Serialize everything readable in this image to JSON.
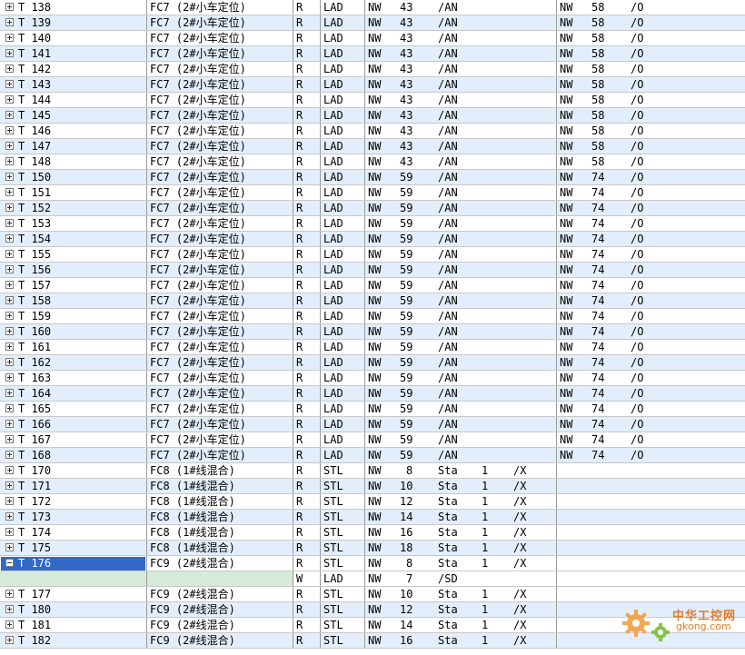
{
  "rows": [
    {
      "name": "T 138",
      "blk": "FC7 (2#小车定位)",
      "rw": "R",
      "lang": "LAD",
      "nw": "NW",
      "n1": "43",
      "a1": "/AN",
      "n2": "NW",
      "m2": "58",
      "a2": "/O"
    },
    {
      "name": "T 139",
      "blk": "FC7 (2#小车定位)",
      "rw": "R",
      "lang": "LAD",
      "nw": "NW",
      "n1": "43",
      "a1": "/AN",
      "n2": "NW",
      "m2": "58",
      "a2": "/O"
    },
    {
      "name": "T 140",
      "blk": "FC7 (2#小车定位)",
      "rw": "R",
      "lang": "LAD",
      "nw": "NW",
      "n1": "43",
      "a1": "/AN",
      "n2": "NW",
      "m2": "58",
      "a2": "/O"
    },
    {
      "name": "T 141",
      "blk": "FC7 (2#小车定位)",
      "rw": "R",
      "lang": "LAD",
      "nw": "NW",
      "n1": "43",
      "a1": "/AN",
      "n2": "NW",
      "m2": "58",
      "a2": "/O"
    },
    {
      "name": "T 142",
      "blk": "FC7 (2#小车定位)",
      "rw": "R",
      "lang": "LAD",
      "nw": "NW",
      "n1": "43",
      "a1": "/AN",
      "n2": "NW",
      "m2": "58",
      "a2": "/O"
    },
    {
      "name": "T 143",
      "blk": "FC7 (2#小车定位)",
      "rw": "R",
      "lang": "LAD",
      "nw": "NW",
      "n1": "43",
      "a1": "/AN",
      "n2": "NW",
      "m2": "58",
      "a2": "/O"
    },
    {
      "name": "T 144",
      "blk": "FC7 (2#小车定位)",
      "rw": "R",
      "lang": "LAD",
      "nw": "NW",
      "n1": "43",
      "a1": "/AN",
      "n2": "NW",
      "m2": "58",
      "a2": "/O"
    },
    {
      "name": "T 145",
      "blk": "FC7 (2#小车定位)",
      "rw": "R",
      "lang": "LAD",
      "nw": "NW",
      "n1": "43",
      "a1": "/AN",
      "n2": "NW",
      "m2": "58",
      "a2": "/O"
    },
    {
      "name": "T 146",
      "blk": "FC7 (2#小车定位)",
      "rw": "R",
      "lang": "LAD",
      "nw": "NW",
      "n1": "43",
      "a1": "/AN",
      "n2": "NW",
      "m2": "58",
      "a2": "/O"
    },
    {
      "name": "T 147",
      "blk": "FC7 (2#小车定位)",
      "rw": "R",
      "lang": "LAD",
      "nw": "NW",
      "n1": "43",
      "a1": "/AN",
      "n2": "NW",
      "m2": "58",
      "a2": "/O"
    },
    {
      "name": "T 148",
      "blk": "FC7 (2#小车定位)",
      "rw": "R",
      "lang": "LAD",
      "nw": "NW",
      "n1": "43",
      "a1": "/AN",
      "n2": "NW",
      "m2": "58",
      "a2": "/O"
    },
    {
      "name": "T 150",
      "blk": "FC7 (2#小车定位)",
      "rw": "R",
      "lang": "LAD",
      "nw": "NW",
      "n1": "59",
      "a1": "/AN",
      "n2": "NW",
      "m2": "74",
      "a2": "/O"
    },
    {
      "name": "T 151",
      "blk": "FC7 (2#小车定位)",
      "rw": "R",
      "lang": "LAD",
      "nw": "NW",
      "n1": "59",
      "a1": "/AN",
      "n2": "NW",
      "m2": "74",
      "a2": "/O"
    },
    {
      "name": "T 152",
      "blk": "FC7 (2#小车定位)",
      "rw": "R",
      "lang": "LAD",
      "nw": "NW",
      "n1": "59",
      "a1": "/AN",
      "n2": "NW",
      "m2": "74",
      "a2": "/O"
    },
    {
      "name": "T 153",
      "blk": "FC7 (2#小车定位)",
      "rw": "R",
      "lang": "LAD",
      "nw": "NW",
      "n1": "59",
      "a1": "/AN",
      "n2": "NW",
      "m2": "74",
      "a2": "/O"
    },
    {
      "name": "T 154",
      "blk": "FC7 (2#小车定位)",
      "rw": "R",
      "lang": "LAD",
      "nw": "NW",
      "n1": "59",
      "a1": "/AN",
      "n2": "NW",
      "m2": "74",
      "a2": "/O"
    },
    {
      "name": "T 155",
      "blk": "FC7 (2#小车定位)",
      "rw": "R",
      "lang": "LAD",
      "nw": "NW",
      "n1": "59",
      "a1": "/AN",
      "n2": "NW",
      "m2": "74",
      "a2": "/O"
    },
    {
      "name": "T 156",
      "blk": "FC7 (2#小车定位)",
      "rw": "R",
      "lang": "LAD",
      "nw": "NW",
      "n1": "59",
      "a1": "/AN",
      "n2": "NW",
      "m2": "74",
      "a2": "/O"
    },
    {
      "name": "T 157",
      "blk": "FC7 (2#小车定位)",
      "rw": "R",
      "lang": "LAD",
      "nw": "NW",
      "n1": "59",
      "a1": "/AN",
      "n2": "NW",
      "m2": "74",
      "a2": "/O"
    },
    {
      "name": "T 158",
      "blk": "FC7 (2#小车定位)",
      "rw": "R",
      "lang": "LAD",
      "nw": "NW",
      "n1": "59",
      "a1": "/AN",
      "n2": "NW",
      "m2": "74",
      "a2": "/O"
    },
    {
      "name": "T 159",
      "blk": "FC7 (2#小车定位)",
      "rw": "R",
      "lang": "LAD",
      "nw": "NW",
      "n1": "59",
      "a1": "/AN",
      "n2": "NW",
      "m2": "74",
      "a2": "/O"
    },
    {
      "name": "T 160",
      "blk": "FC7 (2#小车定位)",
      "rw": "R",
      "lang": "LAD",
      "nw": "NW",
      "n1": "59",
      "a1": "/AN",
      "n2": "NW",
      "m2": "74",
      "a2": "/O"
    },
    {
      "name": "T 161",
      "blk": "FC7 (2#小车定位)",
      "rw": "R",
      "lang": "LAD",
      "nw": "NW",
      "n1": "59",
      "a1": "/AN",
      "n2": "NW",
      "m2": "74",
      "a2": "/O"
    },
    {
      "name": "T 162",
      "blk": "FC7 (2#小车定位)",
      "rw": "R",
      "lang": "LAD",
      "nw": "NW",
      "n1": "59",
      "a1": "/AN",
      "n2": "NW",
      "m2": "74",
      "a2": "/O"
    },
    {
      "name": "T 163",
      "blk": "FC7 (2#小车定位)",
      "rw": "R",
      "lang": "LAD",
      "nw": "NW",
      "n1": "59",
      "a1": "/AN",
      "n2": "NW",
      "m2": "74",
      "a2": "/O"
    },
    {
      "name": "T 164",
      "blk": "FC7 (2#小车定位)",
      "rw": "R",
      "lang": "LAD",
      "nw": "NW",
      "n1": "59",
      "a1": "/AN",
      "n2": "NW",
      "m2": "74",
      "a2": "/O"
    },
    {
      "name": "T 165",
      "blk": "FC7 (2#小车定位)",
      "rw": "R",
      "lang": "LAD",
      "nw": "NW",
      "n1": "59",
      "a1": "/AN",
      "n2": "NW",
      "m2": "74",
      "a2": "/O"
    },
    {
      "name": "T 166",
      "blk": "FC7 (2#小车定位)",
      "rw": "R",
      "lang": "LAD",
      "nw": "NW",
      "n1": "59",
      "a1": "/AN",
      "n2": "NW",
      "m2": "74",
      "a2": "/O"
    },
    {
      "name": "T 167",
      "blk": "FC7 (2#小车定位)",
      "rw": "R",
      "lang": "LAD",
      "nw": "NW",
      "n1": "59",
      "a1": "/AN",
      "n2": "NW",
      "m2": "74",
      "a2": "/O"
    },
    {
      "name": "T 168",
      "blk": "FC7 (2#小车定位)",
      "rw": "R",
      "lang": "LAD",
      "nw": "NW",
      "n1": "59",
      "a1": "/AN",
      "n2": "NW",
      "m2": "74",
      "a2": "/O"
    },
    {
      "name": "T 170",
      "blk": "FC8 (1#线混合)",
      "rw": "R",
      "lang": "STL",
      "nw": "NW",
      "n1": "8",
      "a1": "Sta",
      "s1": "1",
      "x1": "/X"
    },
    {
      "name": "T 171",
      "blk": "FC8 (1#线混合)",
      "rw": "R",
      "lang": "STL",
      "nw": "NW",
      "n1": "10",
      "a1": "Sta",
      "s1": "1",
      "x1": "/X"
    },
    {
      "name": "T 172",
      "blk": "FC8 (1#线混合)",
      "rw": "R",
      "lang": "STL",
      "nw": "NW",
      "n1": "12",
      "a1": "Sta",
      "s1": "1",
      "x1": "/X"
    },
    {
      "name": "T 173",
      "blk": "FC8 (1#线混合)",
      "rw": "R",
      "lang": "STL",
      "nw": "NW",
      "n1": "14",
      "a1": "Sta",
      "s1": "1",
      "x1": "/X"
    },
    {
      "name": "T 174",
      "blk": "FC8 (1#线混合)",
      "rw": "R",
      "lang": "STL",
      "nw": "NW",
      "n1": "16",
      "a1": "Sta",
      "s1": "1",
      "x1": "/X"
    },
    {
      "name": "T 175",
      "blk": "FC8 (1#线混合)",
      "rw": "R",
      "lang": "STL",
      "nw": "NW",
      "n1": "18",
      "a1": "Sta",
      "s1": "1",
      "x1": "/X"
    },
    {
      "name": "T 176",
      "blk": "FC9 (2#线混合)",
      "rw": "R",
      "lang": "STL",
      "nw": "NW",
      "n1": "8",
      "a1": "Sta",
      "s1": "1",
      "x1": "/X",
      "selected": true,
      "expanded": true
    },
    {
      "name": "",
      "blk": "",
      "rw": "W",
      "lang": "LAD",
      "nw": "NW",
      "n1": "7",
      "a1": "/SD",
      "sub": true
    },
    {
      "name": "T 177",
      "blk": "FC9 (2#线混合)",
      "rw": "R",
      "lang": "STL",
      "nw": "NW",
      "n1": "10",
      "a1": "Sta",
      "s1": "1",
      "x1": "/X"
    },
    {
      "name": "T 180",
      "blk": "FC9 (2#线混合)",
      "rw": "R",
      "lang": "STL",
      "nw": "NW",
      "n1": "12",
      "a1": "Sta",
      "s1": "1",
      "x1": "/X"
    },
    {
      "name": "T 181",
      "blk": "FC9 (2#线混合)",
      "rw": "R",
      "lang": "STL",
      "nw": "NW",
      "n1": "14",
      "a1": "Sta",
      "s1": "1",
      "x1": "/X"
    },
    {
      "name": "T 182",
      "blk": "FC9 (2#线混合)",
      "rw": "R",
      "lang": "STL",
      "nw": "NW",
      "n1": "16",
      "a1": "Sta",
      "s1": "1",
      "x1": "/X"
    }
  ],
  "watermark": {
    "title": "中华工控网",
    "url": "gkong.com"
  },
  "colors": {
    "row_alt": "#e2eefb",
    "selection": "#3169c6",
    "subrow": "#d6ead8",
    "grid": "#9a9a9a"
  }
}
